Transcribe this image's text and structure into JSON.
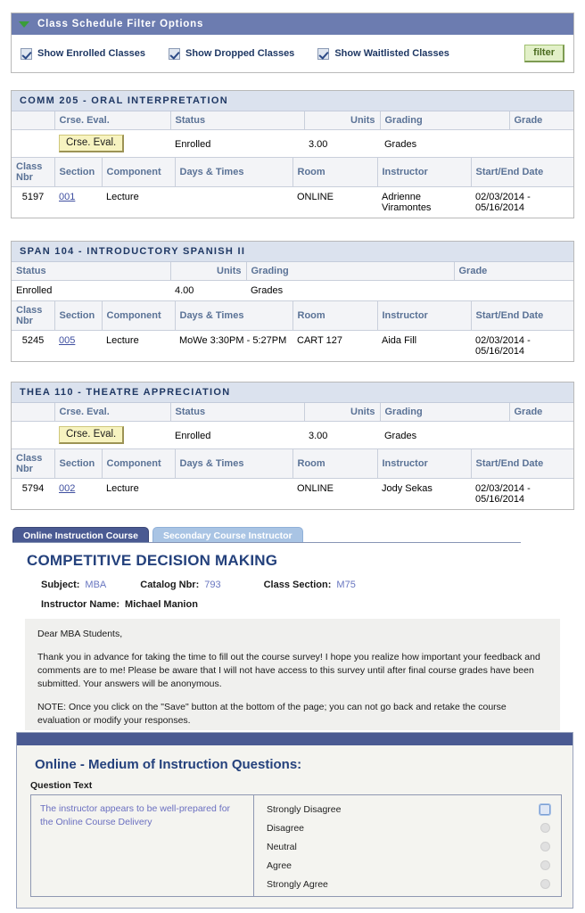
{
  "filter_panel": {
    "title": "Class Schedule Filter Options",
    "collapse_icon": "triangle-down-icon",
    "checkboxes": [
      {
        "label": "Show Enrolled Classes",
        "checked": true
      },
      {
        "label": "Show Dropped Classes",
        "checked": true
      },
      {
        "label": "Show Waitlisted Classes",
        "checked": true
      }
    ],
    "filter_button": "filter"
  },
  "courses": [
    {
      "heading": "COMM 205 - ORAL INTERPRETATION",
      "has_eval": true,
      "status_headers": [
        "",
        "Crse. Eval.",
        "Status",
        "Units",
        "Grading",
        "Grade"
      ],
      "status_row": {
        "eval_button": "Crse. Eval.",
        "status": "Enrolled",
        "units": "3.00",
        "grading": "Grades",
        "grade": ""
      },
      "detail_headers": [
        "Class Nbr",
        "Section",
        "Component",
        "Days & Times",
        "Room",
        "Instructor",
        "Start/End Date"
      ],
      "detail_row": {
        "class_nbr": "5197",
        "section": "001",
        "component": "Lecture",
        "days_times": "",
        "room": "ONLINE",
        "instructor": "Adrienne Viramontes",
        "start_end": "02/03/2014 - 05/16/2014"
      }
    },
    {
      "heading": "SPAN 104 - INTRODUCTORY SPANISH II",
      "has_eval": false,
      "status_headers": [
        "Status",
        "Units",
        "Grading",
        "Grade"
      ],
      "status_row": {
        "eval_button": "",
        "status": "Enrolled",
        "units": "4.00",
        "grading": "Grades",
        "grade": ""
      },
      "detail_headers": [
        "Class Nbr",
        "Section",
        "Component",
        "Days & Times",
        "Room",
        "Instructor",
        "Start/End Date"
      ],
      "detail_row": {
        "class_nbr": "5245",
        "section": "005",
        "component": "Lecture",
        "days_times": "MoWe 3:30PM - 5:27PM",
        "room": "CART 127",
        "instructor": "Aida Fill",
        "start_end": "02/03/2014 - 05/16/2014"
      }
    },
    {
      "heading": "THEA 110 - THEATRE APPRECIATION",
      "has_eval": true,
      "status_headers": [
        "",
        "Crse. Eval.",
        "Status",
        "Units",
        "Grading",
        "Grade"
      ],
      "status_row": {
        "eval_button": "Crse. Eval.",
        "status": "Enrolled",
        "units": "3.00",
        "grading": "Grades",
        "grade": ""
      },
      "detail_headers": [
        "Class Nbr",
        "Section",
        "Component",
        "Days & Times",
        "Room",
        "Instructor",
        "Start/End Date"
      ],
      "detail_row": {
        "class_nbr": "5794",
        "section": "002",
        "component": "Lecture",
        "days_times": "",
        "room": "ONLINE",
        "instructor": "Jody Sekas",
        "start_end": "02/03/2014 - 05/16/2014"
      }
    }
  ],
  "tabs": [
    {
      "label": "Online Instruction Course",
      "active": true
    },
    {
      "label": "Secondary Course Instructor",
      "active": false
    }
  ],
  "survey": {
    "title": "COMPETITIVE DECISION MAKING",
    "subject_label": "Subject:",
    "subject_value": "MBA",
    "catalog_label": "Catalog Nbr:",
    "catalog_value": "793",
    "section_label": "Class Section:",
    "section_value": "M75",
    "instructor_label": "Instructor Name:",
    "instructor_value": "Michael Manion",
    "message": {
      "greeting": "Dear MBA Students,",
      "body": "Thank you in advance for taking the time to fill out the course survey! I hope you realize how important your feedback and comments are to me!  Please be aware that I will not have access to this survey until after final course grades have been submitted.  Your answers will be anonymous.",
      "note": "NOTE: Once you click on the \"Save\" button at the bottom of the page; you can not go back and retake the course evaluation or modify your responses."
    }
  },
  "questions_panel": {
    "title": "Online - Medium of Instruction Questions:",
    "column_header": "Question Text",
    "question_text": "The instructor appears to be well-prepared for the Online Course Delivery",
    "options": [
      {
        "label": "Strongly Disagree",
        "focused": true
      },
      {
        "label": "Disagree",
        "focused": false
      },
      {
        "label": "Neutral",
        "focused": false
      },
      {
        "label": "Agree",
        "focused": false
      },
      {
        "label": "Strongly Agree",
        "focused": false
      }
    ]
  },
  "colors": {
    "header_bar": "#6c7cb0",
    "panel_bar": "#4a5a92",
    "course_head": "#dbe2ee",
    "title_blue": "#24417c",
    "link_blue": "#3f4fa0",
    "filter_green": "#e2f0c8",
    "eval_yellow": "#f7f3c0",
    "collapse_green": "#3a9d3a"
  }
}
